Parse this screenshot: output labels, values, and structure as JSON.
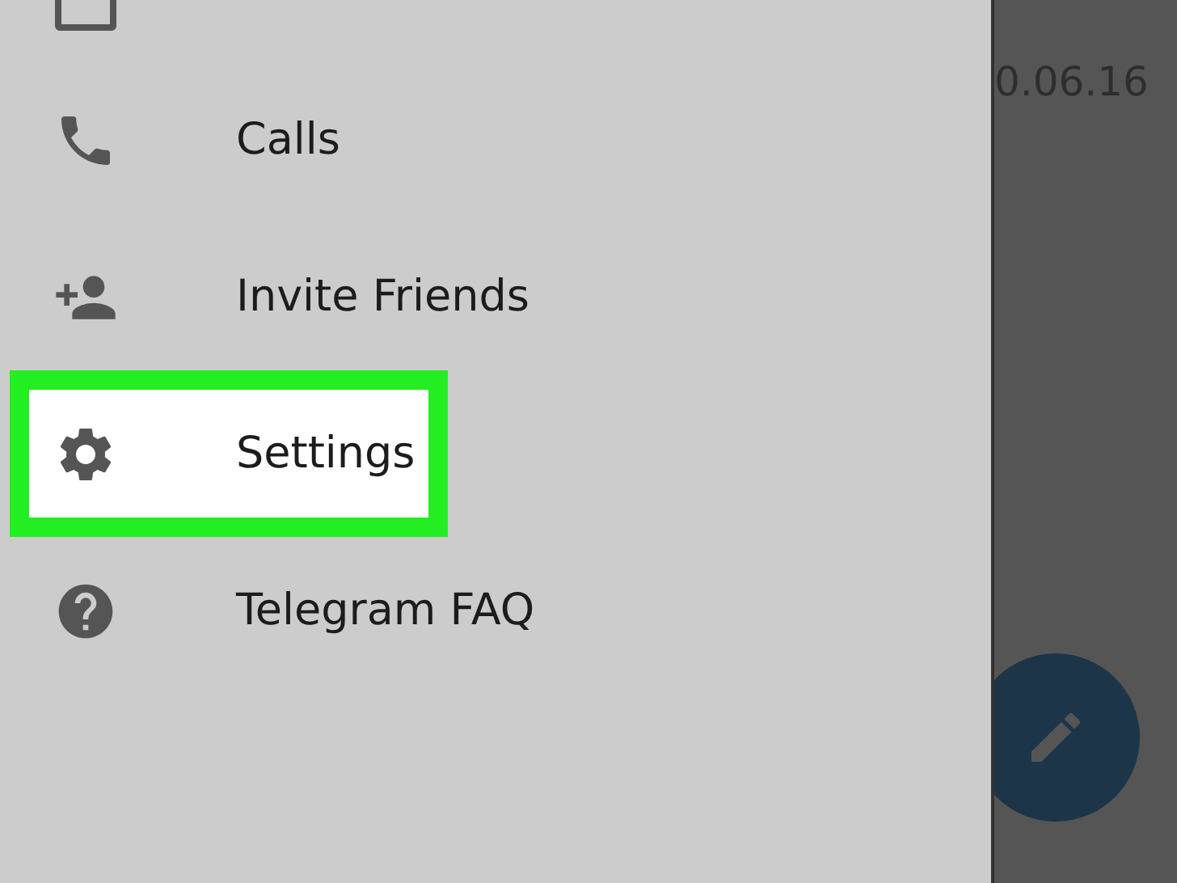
{
  "drawer": {
    "items": [
      {
        "kind": "calls",
        "label": "Calls",
        "highlighted": false
      },
      {
        "kind": "invite",
        "label": "Invite Friends",
        "highlighted": false
      },
      {
        "kind": "settings",
        "label": "Settings",
        "highlighted": true
      },
      {
        "kind": "faq",
        "label": "Telegram FAQ",
        "highlighted": false
      }
    ]
  },
  "chat_list": {
    "date": "0.06.16"
  }
}
